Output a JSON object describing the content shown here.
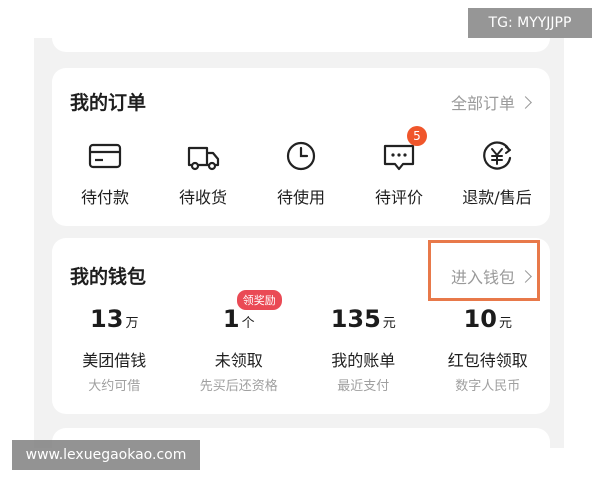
{
  "watermark_top": "TG: MYYJJPP",
  "watermark_bottom": "www.lexuegaokao.com",
  "orders": {
    "title": "我的订单",
    "all_link": "全部订单",
    "items": [
      {
        "label": "待付款",
        "icon": "card-icon"
      },
      {
        "label": "待收货",
        "icon": "truck-icon"
      },
      {
        "label": "待使用",
        "icon": "clock-icon"
      },
      {
        "label": "待评价",
        "icon": "comment-icon",
        "badge": "5"
      },
      {
        "label": "退款/售后",
        "icon": "yuan-icon"
      }
    ]
  },
  "wallet": {
    "title": "我的钱包",
    "enter_link": "进入钱包",
    "items": [
      {
        "value": "13",
        "unit": "万",
        "label": "美团借钱",
        "sub": "大约可借"
      },
      {
        "value": "1",
        "unit": "个",
        "label": "未领取",
        "sub": "先买后还资格",
        "badge": "领奖励"
      },
      {
        "value": "135",
        "unit": "元",
        "label": "我的账单",
        "sub": "最近支付"
      },
      {
        "value": "10",
        "unit": "元",
        "label": "红包待领取",
        "sub": "数字人民币"
      }
    ]
  },
  "colors": {
    "badge": "#f0562b",
    "reward_badge": "#ea4a55",
    "highlight": "#e8794a",
    "background": "#f2f2f2"
  }
}
